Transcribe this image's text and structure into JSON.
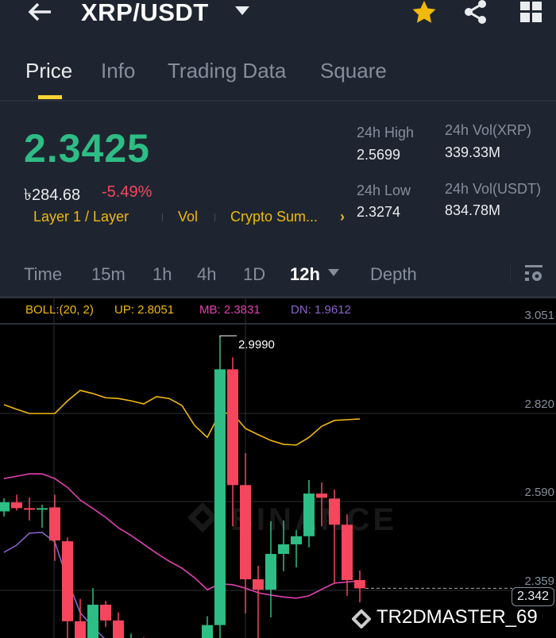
{
  "header": {
    "title": "XRP/USDT"
  },
  "tabs": [
    {
      "label": "Price"
    },
    {
      "label": "Info"
    },
    {
      "label": "Trading Data"
    },
    {
      "label": "Square"
    }
  ],
  "ticker": {
    "last_price": "2.3425",
    "local_price": "৳284.68",
    "change": "-5.49%",
    "tags": [
      "Layer 1 / Layer",
      "Vol",
      "Crypto Sum..."
    ],
    "high_label": "24h High",
    "high": "2.5699",
    "low_label": "24h Low",
    "low": "2.3274",
    "vol_base_label": "24h Vol(XRP)",
    "vol_base": "339.33M",
    "vol_quote_label": "24h Vol(USDT)",
    "vol_quote": "834.78M"
  },
  "timeframes": {
    "items": [
      "Time",
      "15m",
      "1h",
      "4h",
      "1D"
    ],
    "selected": "12h",
    "depth": "Depth"
  },
  "indicator": {
    "name": "BOLL:(20, 2)",
    "up": "UP: 2.8051",
    "mb": "MB: 2.3831",
    "dn": "DN: 1.9612"
  },
  "watermark": "TR2DMASTER_69",
  "colors": {
    "up": "#2ebd85",
    "down": "#f6465d",
    "accent": "#f0b90b",
    "mb": "#e040b0",
    "dn": "#8a63c9"
  },
  "chart_data": {
    "type": "candlestick",
    "price_axis": [
      "3.051",
      "2.820",
      "2.590",
      "2.359"
    ],
    "current_price_label": "2.342",
    "high_marker": "2.9990",
    "candles": [
      {
        "i": 0,
        "o": 2.5425,
        "h": 2.5765,
        "l": 2.529,
        "c": 2.5662
      },
      {
        "i": 1,
        "o": 2.566,
        "h": 2.586,
        "l": 2.545,
        "c": 2.551
      },
      {
        "i": 2,
        "o": 2.551,
        "h": 2.579,
        "l": 2.519,
        "c": 2.547
      },
      {
        "i": 3,
        "o": 2.547,
        "h": 2.56,
        "l": 2.5,
        "c": 2.551
      },
      {
        "i": 4,
        "o": 2.553,
        "h": 2.586,
        "l": 2.414,
        "c": 2.467
      },
      {
        "i": 5,
        "o": 2.465,
        "h": 2.475,
        "l": 2.18,
        "c": 2.257
      },
      {
        "i": 6,
        "o": 2.257,
        "h": 2.315,
        "l": 2.16,
        "c": 2.21
      },
      {
        "i": 7,
        "o": 2.21,
        "h": 2.343,
        "l": 2.18,
        "c": 2.3
      },
      {
        "i": 8,
        "o": 2.3,
        "h": 2.31,
        "l": 2.242,
        "c": 2.259
      },
      {
        "i": 9,
        "o": 2.259,
        "h": 2.28,
        "l": 2.18,
        "c": 2.21
      },
      {
        "i": 10,
        "o": 2.205,
        "h": 2.225,
        "l": 2.18,
        "c": 2.209
      },
      {
        "i": 11,
        "o": 2.209,
        "h": 2.215,
        "l": 2.18,
        "c": 2.205
      },
      {
        "i": 16,
        "o": 2.2,
        "h": 2.27,
        "l": 2.16,
        "c": 2.247
      },
      {
        "i": 17,
        "o": 2.247,
        "h": 2.993,
        "l": 2.18,
        "c": 2.912
      },
      {
        "i": 18,
        "o": 2.912,
        "h": 2.943,
        "l": 2.504,
        "c": 2.611
      },
      {
        "i": 19,
        "o": 2.611,
        "h": 2.694,
        "l": 2.277,
        "c": 2.366
      },
      {
        "i": 20,
        "o": 2.366,
        "h": 2.401,
        "l": 2.18,
        "c": 2.339
      },
      {
        "i": 21,
        "o": 2.339,
        "h": 2.517,
        "l": 2.267,
        "c": 2.432
      },
      {
        "i": 22,
        "o": 2.432,
        "h": 2.519,
        "l": 2.387,
        "c": 2.457
      },
      {
        "i": 23,
        "o": 2.457,
        "h": 2.494,
        "l": 2.397,
        "c": 2.478
      },
      {
        "i": 24,
        "o": 2.478,
        "h": 2.624,
        "l": 2.449,
        "c": 2.589
      },
      {
        "i": 25,
        "o": 2.589,
        "h": 2.618,
        "l": 2.504,
        "c": 2.578
      },
      {
        "i": 26,
        "o": 2.576,
        "h": 2.599,
        "l": 2.354,
        "c": 2.508
      },
      {
        "i": 27,
        "o": 2.508,
        "h": 2.535,
        "l": 2.323,
        "c": 2.364
      },
      {
        "i": 28,
        "o": 2.364,
        "h": 2.389,
        "l": 2.306,
        "c": 2.3425
      }
    ],
    "boll_up": [
      2.82,
      2.808,
      2.797,
      2.797,
      2.797,
      2.83,
      2.857,
      2.849,
      2.838,
      2.836,
      2.83,
      2.822,
      2.841,
      2.836,
      2.818,
      2.766,
      2.735,
      2.799,
      2.797,
      2.758,
      2.742,
      2.727,
      2.717,
      2.715,
      2.735,
      2.764,
      2.779,
      2.781,
      2.783
    ],
    "boll_mb": [
      2.628,
      2.634,
      2.64,
      2.64,
      2.628,
      2.605,
      2.572,
      2.55,
      2.527,
      2.5,
      2.48,
      2.457,
      2.434,
      2.413,
      2.395,
      2.37,
      2.339,
      2.354,
      2.352,
      2.343,
      2.331,
      2.325,
      2.32,
      2.317,
      2.323,
      2.34,
      2.356,
      2.359,
      2.362
    ],
    "boll_dn": [
      2.436,
      2.455,
      2.486,
      2.488,
      2.463,
      2.364,
      2.279,
      2.242,
      2.209,
      null,
      null,
      null,
      null,
      null,
      null,
      null,
      null,
      null,
      null,
      null,
      null,
      null,
      null,
      null,
      null,
      null,
      null,
      null,
      null
    ]
  }
}
